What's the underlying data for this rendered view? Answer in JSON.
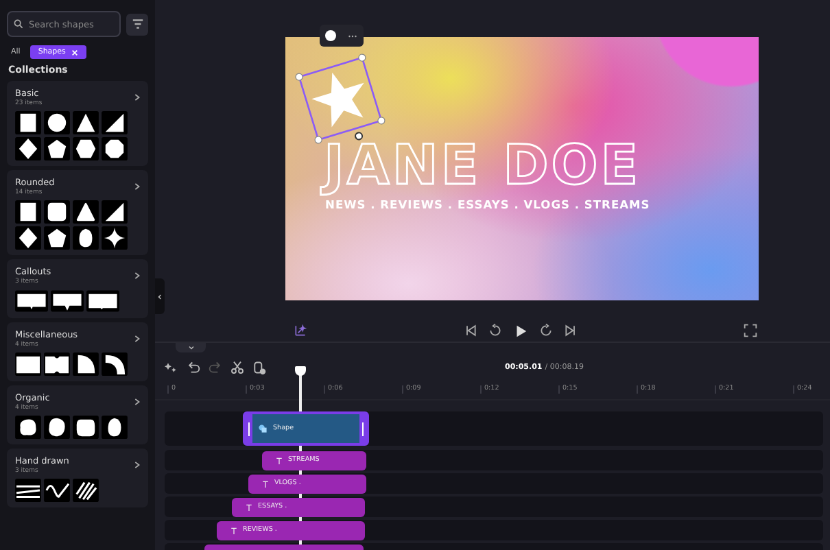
{
  "search": {
    "placeholder": "Search shapes"
  },
  "filters": [
    {
      "label": "All",
      "selected": false
    },
    {
      "label": "Shapes",
      "selected": true
    }
  ],
  "collections_title": "Collections",
  "collections": [
    {
      "name": "Basic",
      "count": "23 items"
    },
    {
      "name": "Rounded",
      "count": "14 items"
    },
    {
      "name": "Callouts",
      "count": "3 items"
    },
    {
      "name": "Miscellaneous",
      "count": "4 items"
    },
    {
      "name": "Organic",
      "count": "4 items"
    },
    {
      "name": "Hand drawn",
      "count": "3 items"
    }
  ],
  "canvas": {
    "title": "JANE DOE",
    "subtitle": "NEWS . REVIEWS . ESSAYS . VLOGS . STREAMS"
  },
  "playback": {
    "current": "00:05.01",
    "total": "/ 00:08.19"
  },
  "toolbar": [
    {
      "kind": "magic",
      "disabled": false
    },
    {
      "kind": "undo",
      "disabled": false
    },
    {
      "kind": "redo",
      "disabled": true
    },
    {
      "kind": "cut",
      "disabled": false
    },
    {
      "kind": "timer",
      "disabled": false
    }
  ],
  "ruler": [
    "0",
    "0:03",
    "0:06",
    "0:09",
    "0:12",
    "0:15",
    "0:18",
    "0:21",
    "0:24"
  ],
  "tracks": [
    {
      "kind": "shape",
      "label": "Shape",
      "selected": true
    },
    {
      "kind": "text",
      "label": "STREAMS",
      "selected": false
    },
    {
      "kind": "text",
      "label": "VLOGS .",
      "selected": false
    },
    {
      "kind": "text",
      "label": "ESSAYS .",
      "selected": false
    },
    {
      "kind": "text",
      "label": "REVIEWS .",
      "selected": false
    },
    {
      "kind": "text",
      "selected": false
    }
  ]
}
